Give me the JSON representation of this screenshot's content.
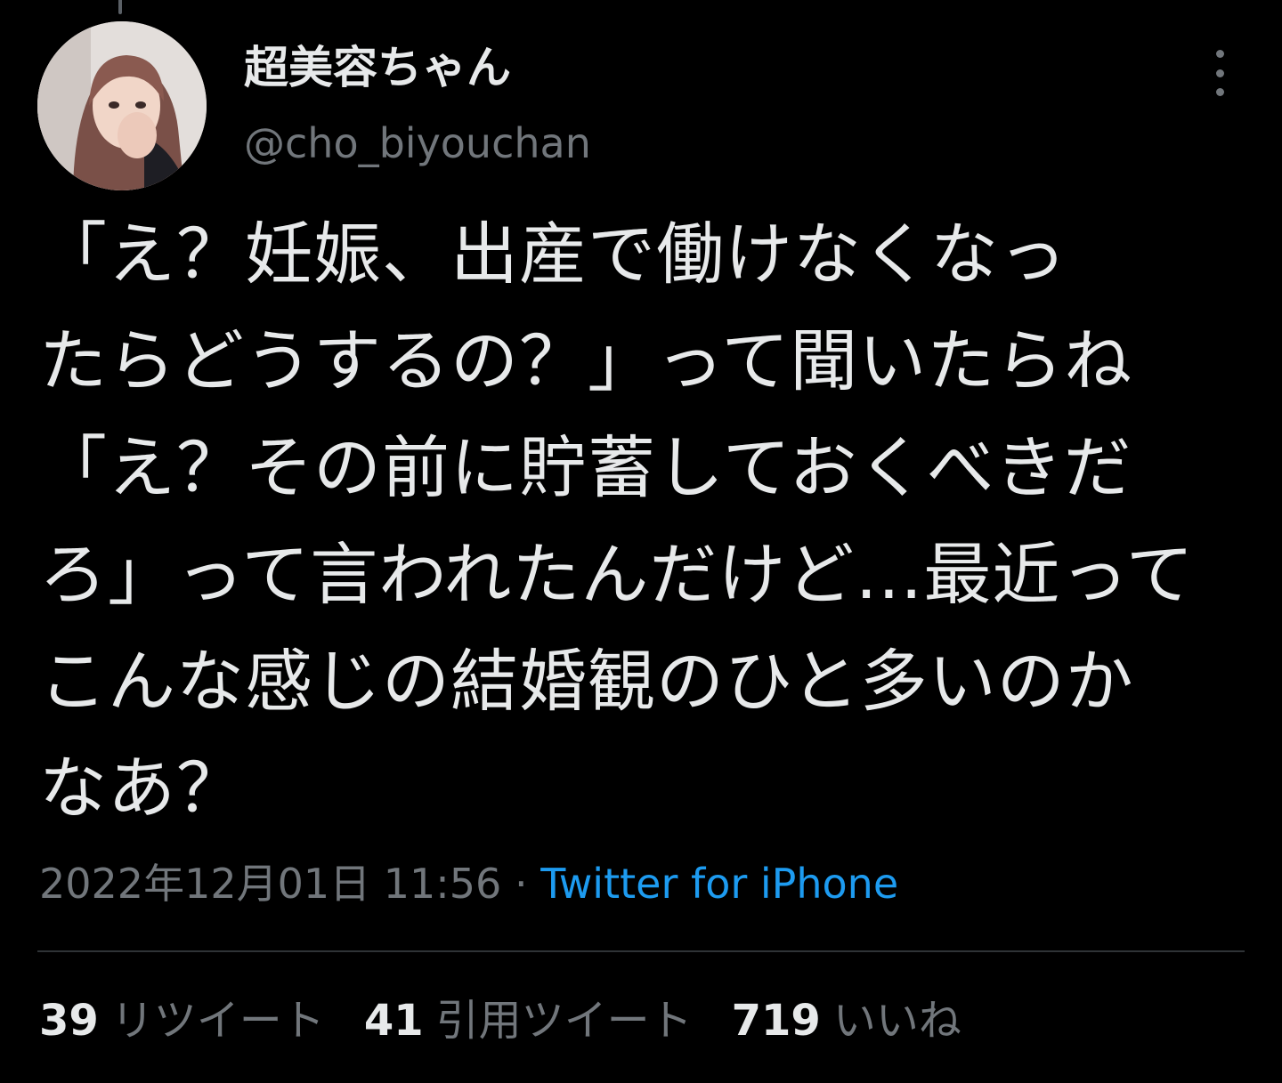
{
  "tweet": {
    "author": {
      "display_name": "超美容ちゃん",
      "handle": "@cho_biyouchan",
      "avatar_icon": "user-photo-avatar"
    },
    "more_icon": "more-vertical-icon",
    "body_lines": [
      "「え？妊娠、出産で働けなくなっ",
      "たらどうするの？」って聞いたらね",
      "「え？その前に貯蓄しておくべきだ",
      "ろ」って言われたんだけど…最近って",
      "こんな感じの結婚観のひと多いのか",
      "なあ？"
    ],
    "timestamp": "2022年12月01日 11:56",
    "separator": " · ",
    "source": "Twitter for iPhone",
    "stats": {
      "retweets": {
        "count": "39",
        "label": "リツイート"
      },
      "quotes": {
        "count": "41",
        "label": "引用ツイート"
      },
      "likes": {
        "count": "719",
        "label": "いいね"
      }
    }
  },
  "colors": {
    "background": "#000000",
    "text_primary": "#e7e9ea",
    "text_secondary": "#71767b",
    "link": "#1d9bf0",
    "divider": "#2f3336"
  }
}
